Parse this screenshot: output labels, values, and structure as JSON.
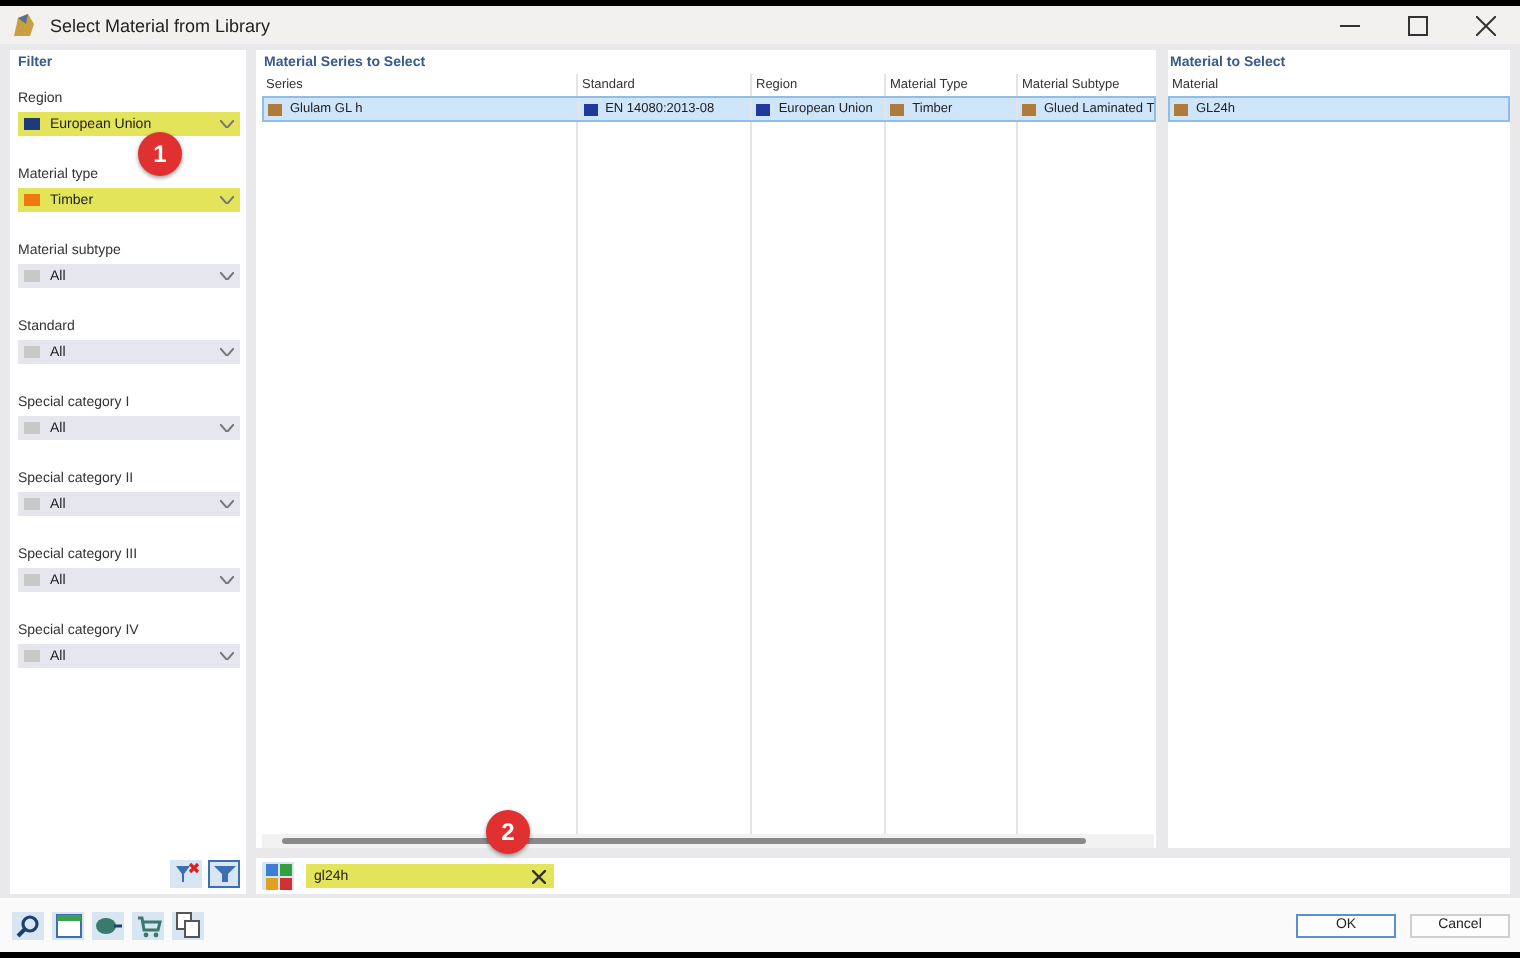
{
  "window": {
    "title": "Select Material from Library"
  },
  "filter": {
    "title": "Filter",
    "fields": [
      {
        "label": "Region",
        "value": "European Union",
        "color": "#1f3a7a",
        "highlighted": true
      },
      {
        "label": "Material type",
        "value": "Timber",
        "color": "#f07a10",
        "highlighted": true
      },
      {
        "label": "Material subtype",
        "value": "All",
        "color": "#c8c8c8",
        "highlighted": false
      },
      {
        "label": "Standard",
        "value": "All",
        "color": "#c8c8c8",
        "highlighted": false
      },
      {
        "label": "Special category I",
        "value": "All",
        "color": "#c8c8c8",
        "highlighted": false
      },
      {
        "label": "Special category II",
        "value": "All",
        "color": "#c8c8c8",
        "highlighted": false
      },
      {
        "label": "Special category III",
        "value": "All",
        "color": "#c8c8c8",
        "highlighted": false
      },
      {
        "label": "Special category IV",
        "value": "All",
        "color": "#c8c8c8",
        "highlighted": false
      }
    ]
  },
  "series_panel": {
    "title": "Material Series to Select",
    "columns": [
      "Series",
      "Standard",
      "Region",
      "Material Type",
      "Material Subtype"
    ],
    "rows": [
      {
        "selected": true,
        "cells": [
          {
            "text": "Glulam GL h",
            "color": "#b07a3a"
          },
          {
            "text": "EN 14080:2013-08",
            "color": "#1f3a9a"
          },
          {
            "text": "European Union",
            "color": "#1f3a9a"
          },
          {
            "text": "Timber",
            "color": "#b07a3a"
          },
          {
            "text": "Glued Laminated T",
            "color": "#b07a3a"
          }
        ]
      }
    ]
  },
  "materials_panel": {
    "title": "Material to Select",
    "columns": [
      "Material"
    ],
    "rows": [
      {
        "text": "GL24h",
        "color": "#b07a3a",
        "selected": true
      }
    ]
  },
  "search": {
    "value": "gl24h",
    "highlighted": true
  },
  "callouts": [
    {
      "text": "1"
    },
    {
      "text": "2"
    }
  ],
  "buttons": [
    {
      "label": "OK",
      "default": true
    },
    {
      "label": "Cancel",
      "default": false
    }
  ]
}
